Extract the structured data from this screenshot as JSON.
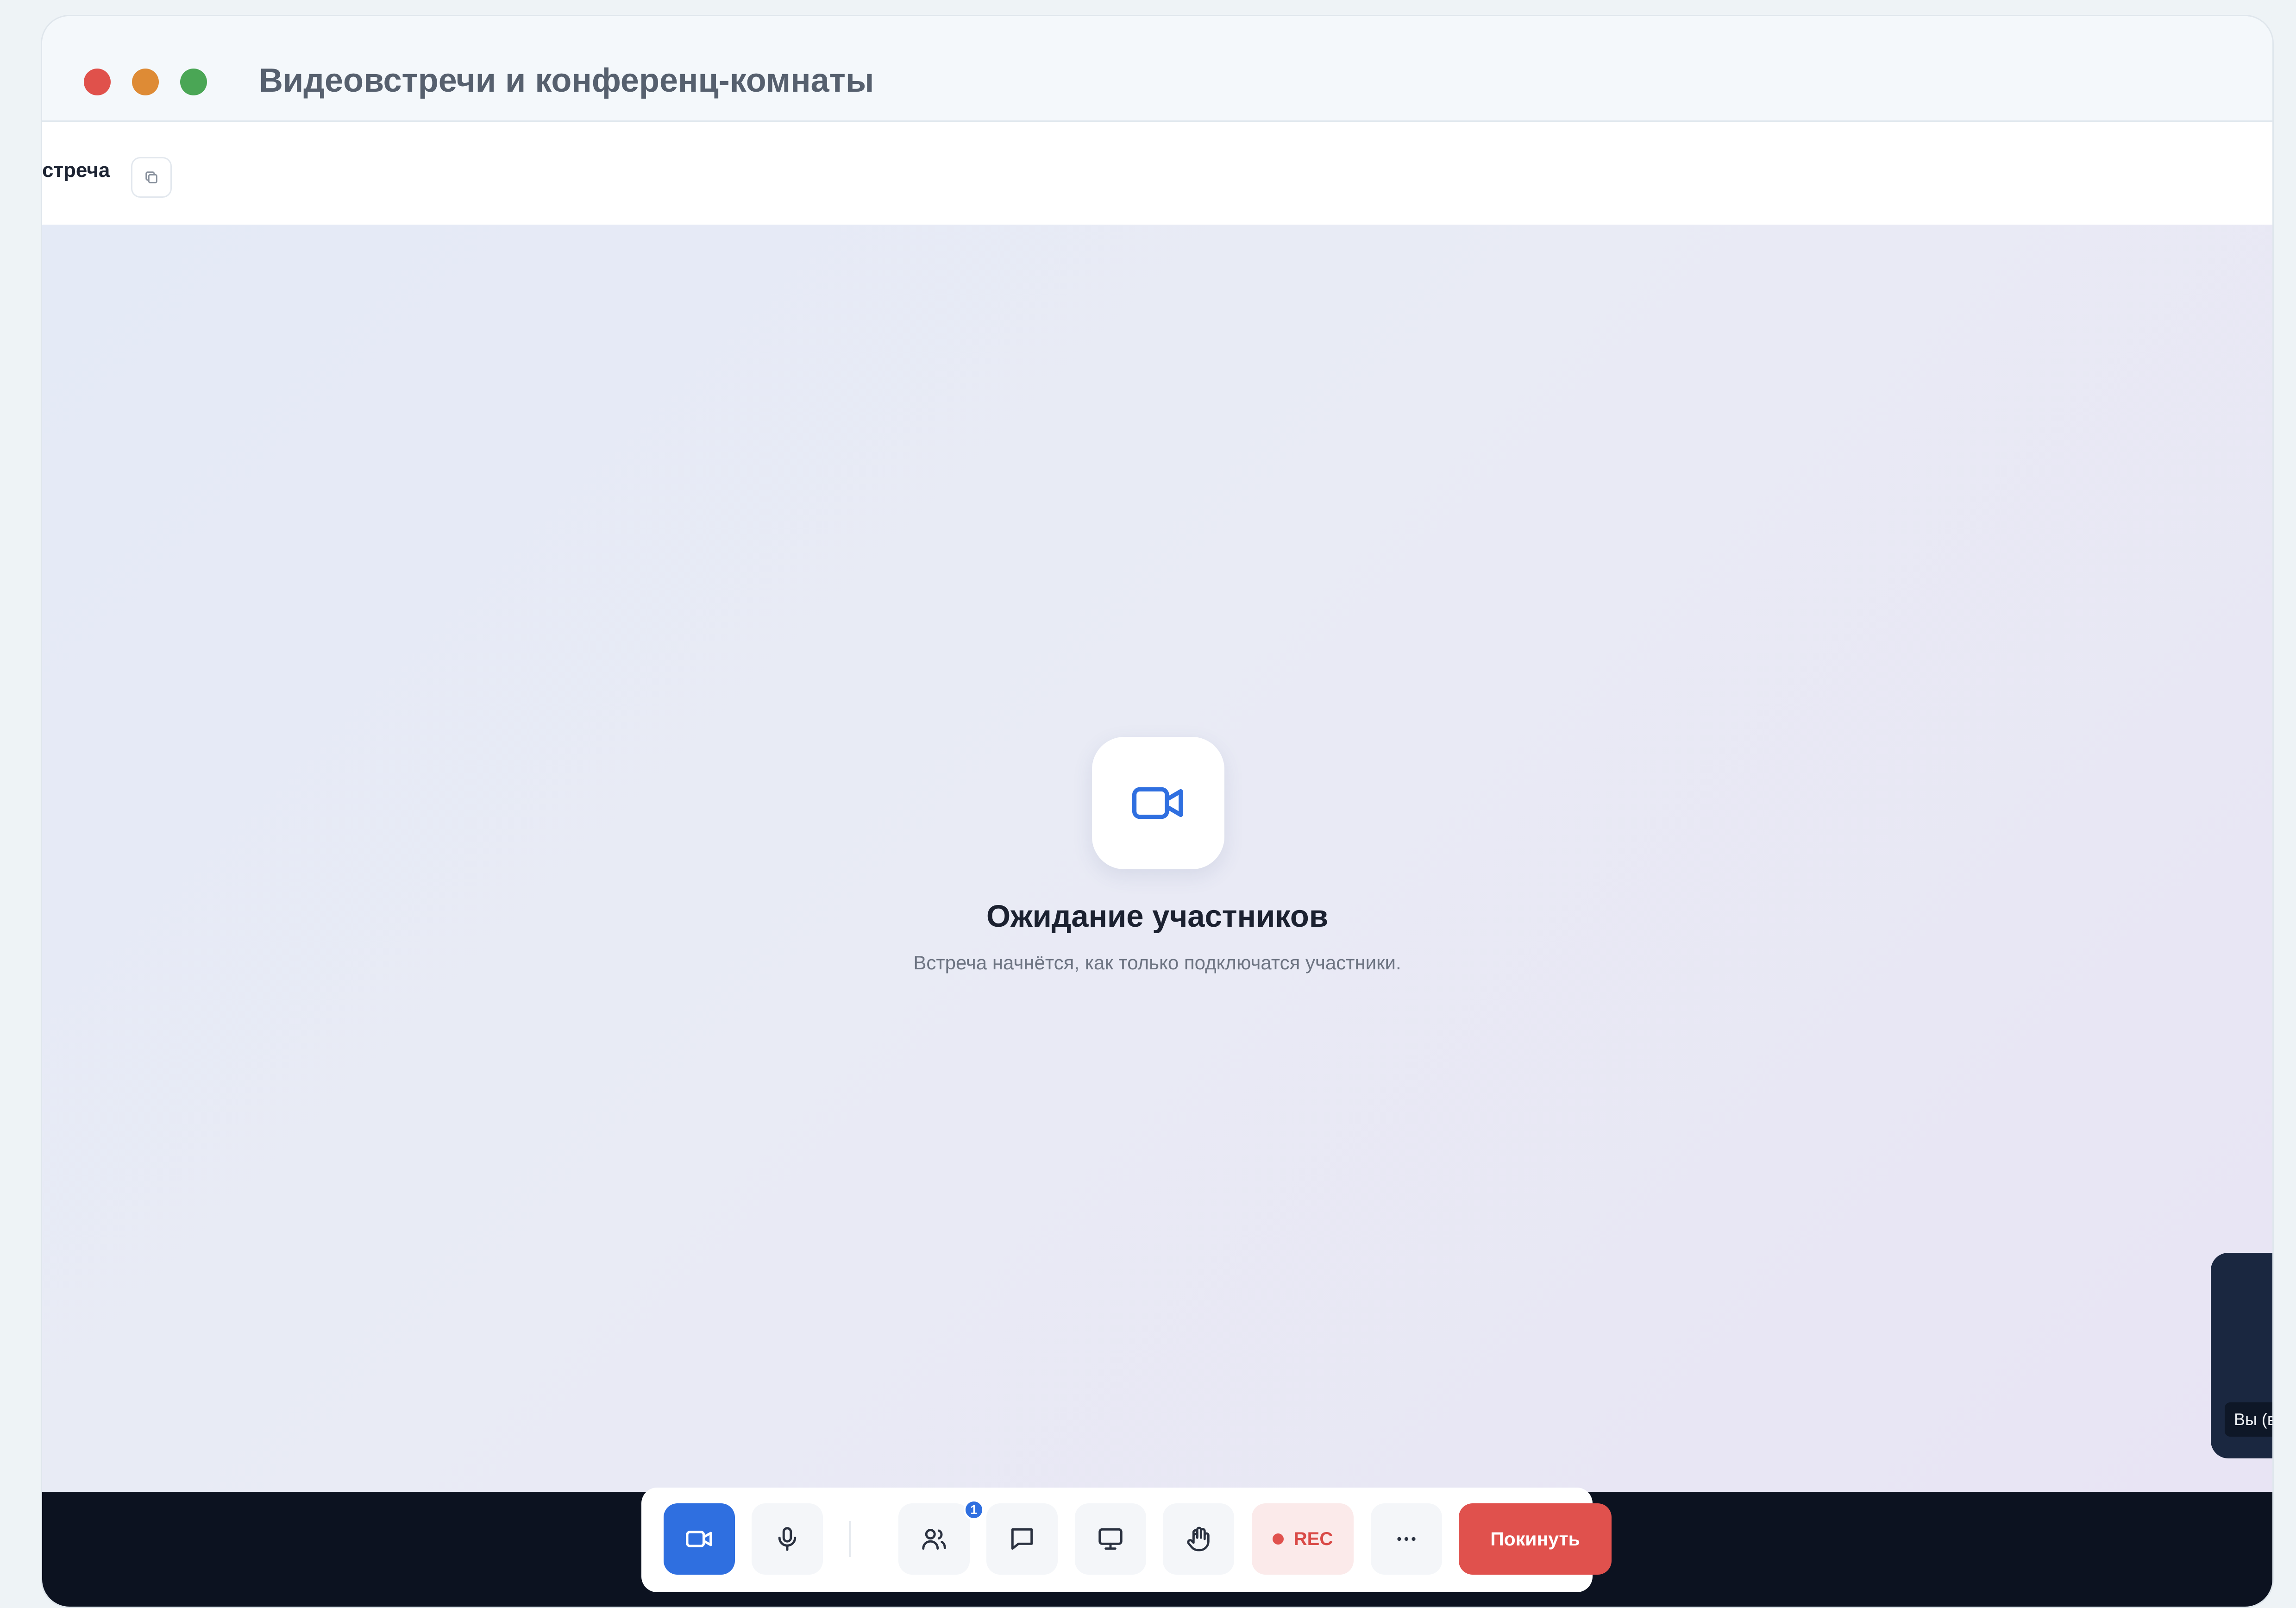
{
  "window": {
    "title": "Видеовстречи и конференц-комнаты"
  },
  "subbar": {
    "meeting_name": "стреча",
    "copy_icon": "copy-icon"
  },
  "stage": {
    "hero_icon": "video-camera-icon",
    "title": "Ожидание участников",
    "subtitle": "Встреча начнётся, как только подключатся участники.",
    "self_tile_label": "Вы (вы)"
  },
  "toolbar": {
    "buttons": [
      {
        "name": "camera",
        "icon": "video-camera-icon",
        "active": true
      },
      {
        "name": "microphone",
        "icon": "microphone-icon"
      },
      {
        "name": "participants",
        "icon": "participants-icon",
        "badge": "1"
      },
      {
        "name": "chat",
        "icon": "chat-icon"
      },
      {
        "name": "screen-share",
        "icon": "monitor-icon"
      },
      {
        "name": "raise-hand",
        "icon": "hand-icon"
      },
      {
        "name": "record",
        "icon": "record-dot-icon"
      },
      {
        "name": "more",
        "icon": "more-icon"
      },
      {
        "name": "leave"
      }
    ],
    "participants_badge": "1",
    "rec_label": "REC",
    "leave_label": "Покинуть"
  },
  "colors": {
    "accent": "#2f6fe0",
    "danger": "#e0514d",
    "bottom_bar": "#0c1220",
    "traffic_red": "#e0514b",
    "traffic_orange": "#de8b35",
    "traffic_green": "#4aa655"
  }
}
